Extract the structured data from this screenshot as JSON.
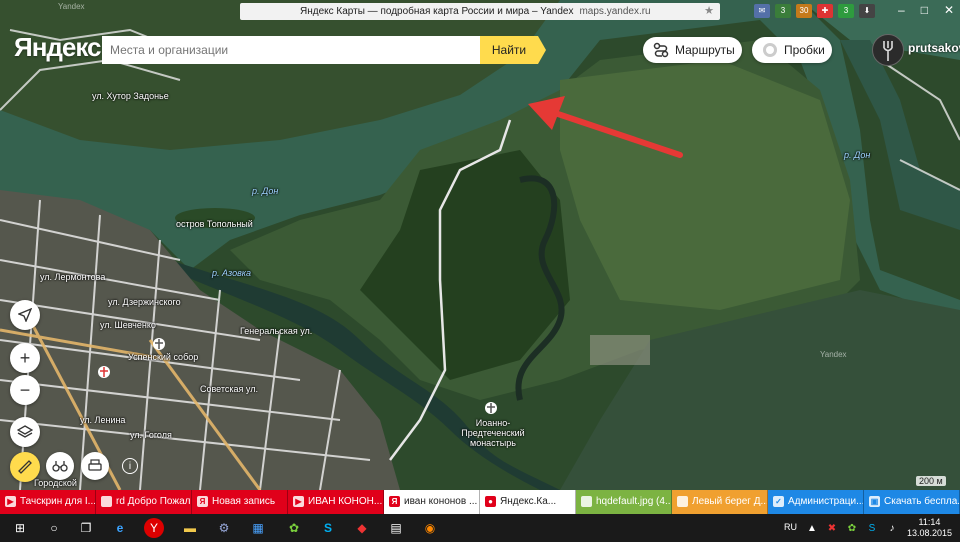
{
  "browser": {
    "page_title": "Яндекс Карты — подробная карта России и мира – Yandex",
    "domain": "maps.yandex.ru",
    "tray_badges": [
      "3",
      "30",
      "3"
    ]
  },
  "header": {
    "logo": "Яндекс",
    "search_placeholder": "Места и организации",
    "search_button": "Найти",
    "routes_button": "Маршруты",
    "traffic_button": "Пробки",
    "username": "prutsakov"
  },
  "map_labels": {
    "street_khutor": "ул. Хутор Задонье",
    "river_don_1": "р. Дон",
    "river_don_2": "р. Дон",
    "island": "остров Топольный",
    "river_azovka": "р. Азовка",
    "street_lermontov": "ул. Лермонтова",
    "street_generalskaya": "Генеральская ул.",
    "street_dzerzhinsky": "ул. Дзержинского",
    "street_shevchenko": "ул. Шевченко",
    "street_sovetskaya": "Советская ул.",
    "street_gogol": "ул. Гоголя",
    "street_lenina": "ул. Ленина",
    "cathedral": "Успенский собор",
    "monastery": "Иоанно-Предтеченский монастырь",
    "town_lower": "Городской",
    "watermark": "Yandex",
    "scale": "200 м"
  },
  "tabs": [
    {
      "label": "Тачскрин для I...",
      "color": "#e0001a",
      "icon_text": "▶"
    },
    {
      "label": "rd Добро Пожало...",
      "color": "#e0001a",
      "icon_text": ""
    },
    {
      "label": "Новая запись",
      "color": "#e0001a",
      "icon_text": "Я"
    },
    {
      "label": "ИВАН КОНОН...",
      "color": "#e0001a",
      "icon_text": "▶"
    },
    {
      "label": "иван кононов ...",
      "color": "#ffffff",
      "icon_text": "Я"
    },
    {
      "label": "Яндекс.Ка...",
      "color": "#ffffff",
      "icon_text": "●"
    },
    {
      "label": "hqdefault.jpg (4...",
      "color": "#7cb342",
      "icon_text": ""
    },
    {
      "label": "Левый берег Д...",
      "color": "#f0a030",
      "icon_text": ""
    },
    {
      "label": "Администраци...",
      "color": "#1e88e5",
      "icon_text": "✓"
    },
    {
      "label": "Скачать беспла...",
      "color": "#1e88e5",
      "icon_text": "▣"
    }
  ],
  "taskbar": {
    "language": "RU",
    "time": "11:14",
    "date": "13.08.2015"
  },
  "colors": {
    "accent": "#ffdb4d",
    "arrow": "#e53935",
    "river": "#35624f"
  }
}
